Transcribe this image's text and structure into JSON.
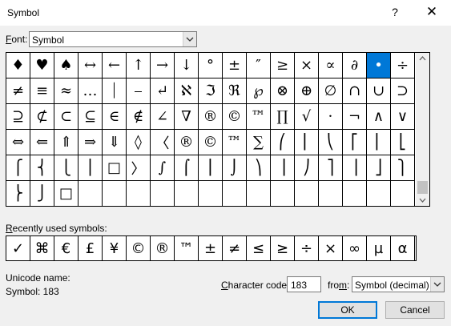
{
  "window": {
    "title": "Symbol",
    "help": "?",
    "close": "✕"
  },
  "font": {
    "label_prefix": "",
    "label_accel": "F",
    "label_rest": "ont:",
    "value": "Symbol"
  },
  "symbols": [
    "♦",
    "♥",
    "♠",
    "↔",
    "←",
    "↑",
    "→",
    "↓",
    "°",
    "±",
    "″",
    "≥",
    "×",
    "∝",
    "∂",
    "•",
    "÷",
    "≠",
    "≡",
    "≈",
    "…",
    "⏐",
    "⎯",
    "↵",
    "ℵ",
    "ℑ",
    "ℜ",
    "℘",
    "⊗",
    "⊕",
    "∅",
    "∩",
    "∪",
    "⊃",
    "⊇",
    "⊄",
    "⊂",
    "⊆",
    "∈",
    "∉",
    "∠",
    "∇",
    "®",
    "©",
    "™",
    "∏",
    "√",
    "⋅",
    "¬",
    "∧",
    "∨",
    "⇔",
    "⇐",
    "⇑",
    "⇒",
    "⇓",
    "◊",
    "〈",
    "®",
    "©",
    "™",
    "∑",
    "⎛",
    "⎜",
    "⎝",
    "⎡",
    "⎢",
    "⎣",
    "⎧",
    "⎨",
    "⎩",
    "⎪",
    "□",
    "〉",
    "∫",
    "⌠",
    "⎮",
    "⌡",
    "⎞",
    "⎟",
    "⎠",
    "⎤",
    "⎥",
    "⎦",
    "⎫",
    "⎬",
    "⎭",
    "□",
    "",
    "",
    "",
    "",
    "",
    "",
    "",
    "",
    "",
    "",
    "",
    "",
    "",
    ""
  ],
  "selected_index": 15,
  "colors": {
    "selection": "#0078d7",
    "accent": "#0078d7"
  },
  "recent": {
    "label_accel": "R",
    "label_rest": "ecently used symbols:",
    "items": [
      "✓",
      "⌘",
      "€",
      "£",
      "¥",
      "©",
      "®",
      "™",
      "±",
      "≠",
      "≤",
      "≥",
      "÷",
      "×",
      "∞",
      "µ",
      "α"
    ]
  },
  "unicode": {
    "label": "Unicode name:",
    "value": "Symbol: 183"
  },
  "char_code": {
    "label_accel": "C",
    "label_rest": "haracter code:",
    "value": "183"
  },
  "from": {
    "label_prefix": "fro",
    "label_accel": "m",
    "label_rest": ":",
    "value": "Symbol (decimal)"
  },
  "buttons": {
    "ok": "OK",
    "cancel": "Cancel"
  }
}
